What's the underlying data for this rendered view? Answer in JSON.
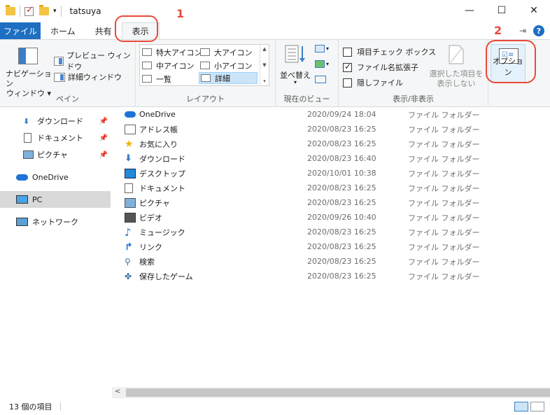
{
  "window": {
    "title": "tatsuya",
    "controls": {
      "minimize": "—",
      "maximize": "☐",
      "close": "✕"
    }
  },
  "tabs": {
    "file": "ファイル",
    "home": "ホーム",
    "share": "共有",
    "view": "表示"
  },
  "ribbon": {
    "pane_group": {
      "nav_pane_line1": "ナビゲーション",
      "nav_pane_line2": "ウィンドウ",
      "preview_pane": "プレビュー ウィンドウ",
      "details_pane": "詳細ウィンドウ",
      "label": "ペイン"
    },
    "layout_group": {
      "extra_large": "特大アイコン",
      "large": "大アイコン",
      "medium": "中アイコン",
      "small": "小アイコン",
      "list": "一覧",
      "details": "詳細",
      "label": "レイアウト"
    },
    "current_view_group": {
      "sort_by": "並べ替え",
      "label": "現在のビュー"
    },
    "show_hide_group": {
      "item_checkboxes": "項目チェック ボックス",
      "file_name_ext": "ファイル名拡張子",
      "hidden_items": "隠しファイル",
      "hide_selected_line1": "選択した項目を",
      "hide_selected_line2": "表示しない",
      "label": "表示/非表示"
    },
    "options": "オプション"
  },
  "annotations": {
    "marker1": "1",
    "marker2": "2",
    "accent": "#e84a3a"
  },
  "navigation": {
    "items": [
      {
        "label": "ダウンロード",
        "icon": "download-arrow-icon",
        "pinned": true
      },
      {
        "label": "ドキュメント",
        "icon": "document-icon",
        "pinned": true
      },
      {
        "label": "ピクチャ",
        "icon": "pictures-icon",
        "pinned": true
      },
      {
        "label": "OneDrive",
        "icon": "cloud-icon"
      },
      {
        "label": "PC",
        "icon": "pc-icon",
        "selected": true
      },
      {
        "label": "ネットワーク",
        "icon": "network-icon"
      }
    ]
  },
  "files": [
    {
      "name": "OneDrive",
      "date": "2020/09/24 18:04",
      "type": "ファイル フォルダー",
      "icon": "cloud-icon"
    },
    {
      "name": "アドレス帳",
      "date": "2020/08/23 16:25",
      "type": "ファイル フォルダー",
      "icon": "contacts-icon"
    },
    {
      "name": "お気に入り",
      "date": "2020/08/23 16:25",
      "type": "ファイル フォルダー",
      "icon": "star-icon"
    },
    {
      "name": "ダウンロード",
      "date": "2020/08/23 16:40",
      "type": "ファイル フォルダー",
      "icon": "download-arrow-icon"
    },
    {
      "name": "デスクトップ",
      "date": "2020/10/01 10:38",
      "type": "ファイル フォルダー",
      "icon": "desktop-icon"
    },
    {
      "name": "ドキュメント",
      "date": "2020/08/23 16:25",
      "type": "ファイル フォルダー",
      "icon": "document-icon"
    },
    {
      "name": "ピクチャ",
      "date": "2020/08/23 16:25",
      "type": "ファイル フォルダー",
      "icon": "pictures-icon"
    },
    {
      "name": "ビデオ",
      "date": "2020/09/26 10:40",
      "type": "ファイル フォルダー",
      "icon": "video-icon"
    },
    {
      "name": "ミュージック",
      "date": "2020/08/23 16:25",
      "type": "ファイル フォルダー",
      "icon": "music-icon"
    },
    {
      "name": "リンク",
      "date": "2020/08/23 16:25",
      "type": "ファイル フォルダー",
      "icon": "link-icon"
    },
    {
      "name": "検索",
      "date": "2020/08/23 16:25",
      "type": "ファイル フォルダー",
      "icon": "search-icon"
    },
    {
      "name": "保存したゲーム",
      "date": "2020/08/23 16:25",
      "type": "ファイル フォルダー",
      "icon": "games-icon"
    }
  ],
  "status": {
    "item_count": "13 個の項目"
  }
}
